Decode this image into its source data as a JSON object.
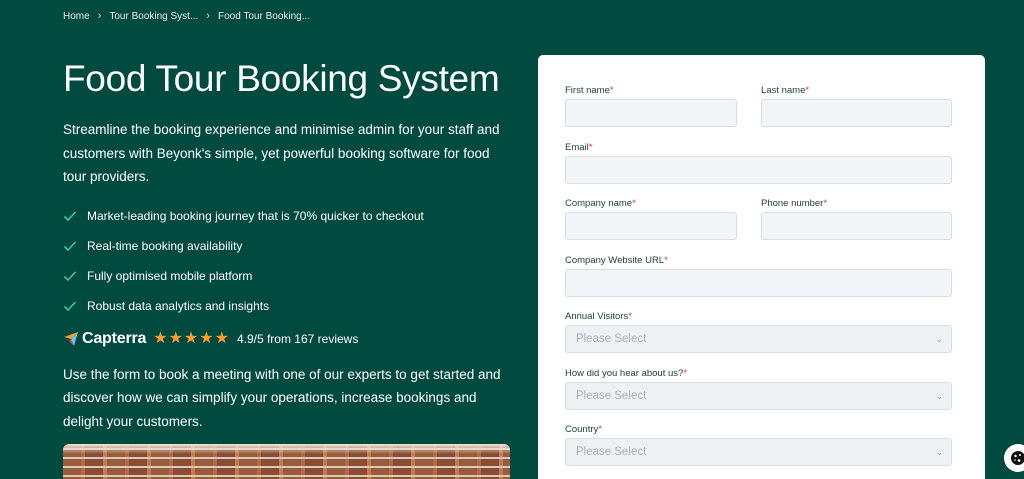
{
  "breadcrumb": {
    "items": [
      "Home",
      "Tour Booking Syst...",
      "Food Tour Booking..."
    ]
  },
  "hero": {
    "title": "Food Tour Booking System",
    "intro": "Streamline the booking experience and minimise admin for your staff and customers with Beyonk's simple, yet powerful booking software for food tour providers.",
    "features": [
      "Market-leading booking journey that is 70% quicker to checkout",
      "Real-time booking availability",
      "Fully optimised mobile platform",
      "Robust data analytics and insights"
    ],
    "capterra": {
      "brand": "Capterra",
      "stars": 5,
      "rating_text": "4.9/5 from 167 reviews"
    },
    "cta": "Use the form to book a meeting with one of our experts to get started and discover how we can simplify your operations, increase bookings and delight your customers."
  },
  "form": {
    "first_name_label": "First name",
    "last_name_label": "Last name",
    "email_label": "Email",
    "company_name_label": "Company name",
    "phone_label": "Phone number",
    "website_label": "Company Website URL",
    "visitors_label": "Annual Visitors",
    "hear_label": "How did you hear about us?",
    "country_label": "Country",
    "required_mark": "*",
    "select_placeholder": "Please Select",
    "first_name_value": "",
    "last_name_value": "",
    "email_value": "",
    "company_name_value": "",
    "phone_value": "",
    "website_value": ""
  },
  "colors": {
    "background": "#004a3f",
    "star": "#ff9d28",
    "check": "#3fc79a",
    "required": "#e0312c"
  },
  "icons": {
    "separator": "chevron-right-icon",
    "feature": "check-icon",
    "capterra": "capterra-logo-icon",
    "select": "chevron-down-icon",
    "cookie": "cookie-icon"
  }
}
